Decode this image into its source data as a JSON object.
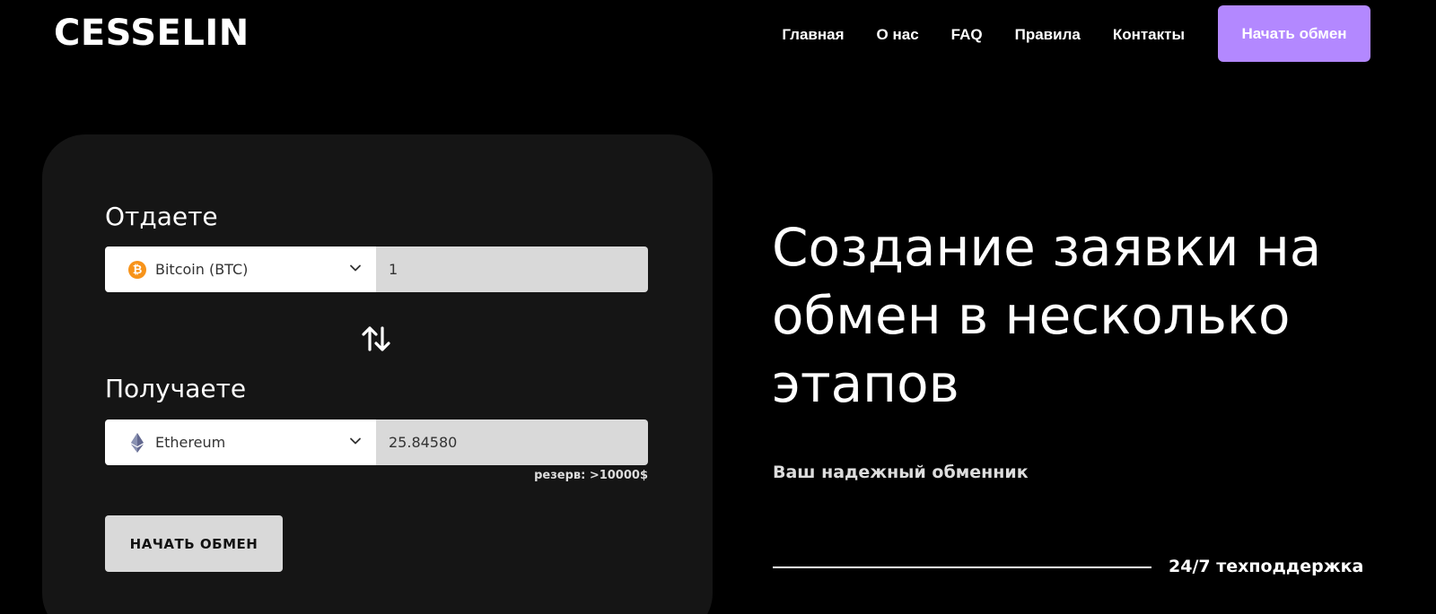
{
  "header": {
    "logo": "CESSELIN",
    "nav": [
      "Главная",
      "О нас",
      "FAQ",
      "Правила",
      "Контакты"
    ],
    "cta_label": "Начать обмен",
    "accent_color": "#b388ff"
  },
  "exchange": {
    "give_label": "Отдаете",
    "give_currency": "Bitcoin (BTC)",
    "give_currency_icon": "bitcoin-icon",
    "give_amount": "1",
    "get_label": "Получаете",
    "get_currency": "Ethereum",
    "get_currency_icon": "ethereum-icon",
    "get_amount": "25.84580",
    "reserve": "резерв: >10000$",
    "submit_label": "НАЧАТЬ ОБМЕН"
  },
  "hero": {
    "title": "Создание заявки на обмен в несколько этапов",
    "subtitle": "Ваш надежный обменник",
    "support": "24/7 техподдержка"
  }
}
